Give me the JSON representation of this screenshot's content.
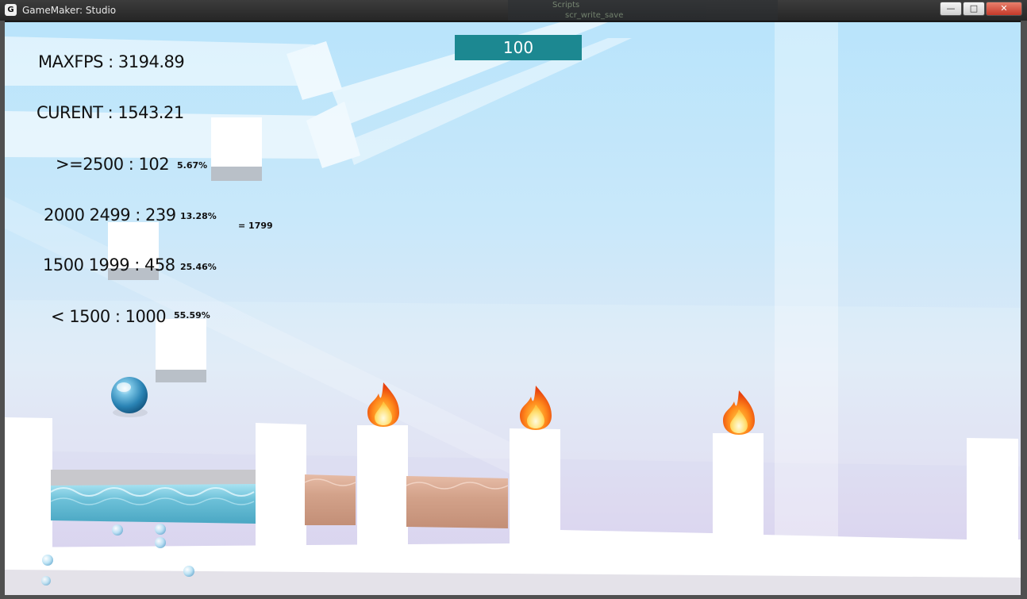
{
  "window": {
    "title": "GameMaker: Studio",
    "icon": "gamemaker-logo-icon",
    "controls": {
      "minimize": "—",
      "maximize": "□",
      "close": "✕"
    },
    "background_editor": {
      "item1": "Scripts",
      "item2": "scr_write_save"
    }
  },
  "hud": {
    "maxfps_label": "MAXFPS : 3194.89",
    "current_label": "CURENT : 1543.21",
    "ranges": [
      {
        "label": ">=2500 : 102",
        "percent": "5.67%"
      },
      {
        "label": "2000 2499 : 239",
        "percent": "13.28%"
      },
      {
        "label": "1500 1999 : 458",
        "percent": "25.46%"
      },
      {
        "label": "< 1500 : 1000",
        "percent": "55.59%"
      }
    ],
    "total": "= 1799",
    "score": "100"
  },
  "colors": {
    "score_box": "#1c8891",
    "water": "#74c6dc",
    "sand": "#d6a790",
    "sky_top": "#b9e4fb",
    "sky_bottom": "#d6d0ee"
  },
  "sprites": {
    "player": "water-droplet-ball",
    "hazard": "fire-flame-icon",
    "pool": "water-pool",
    "block": "white-block"
  }
}
